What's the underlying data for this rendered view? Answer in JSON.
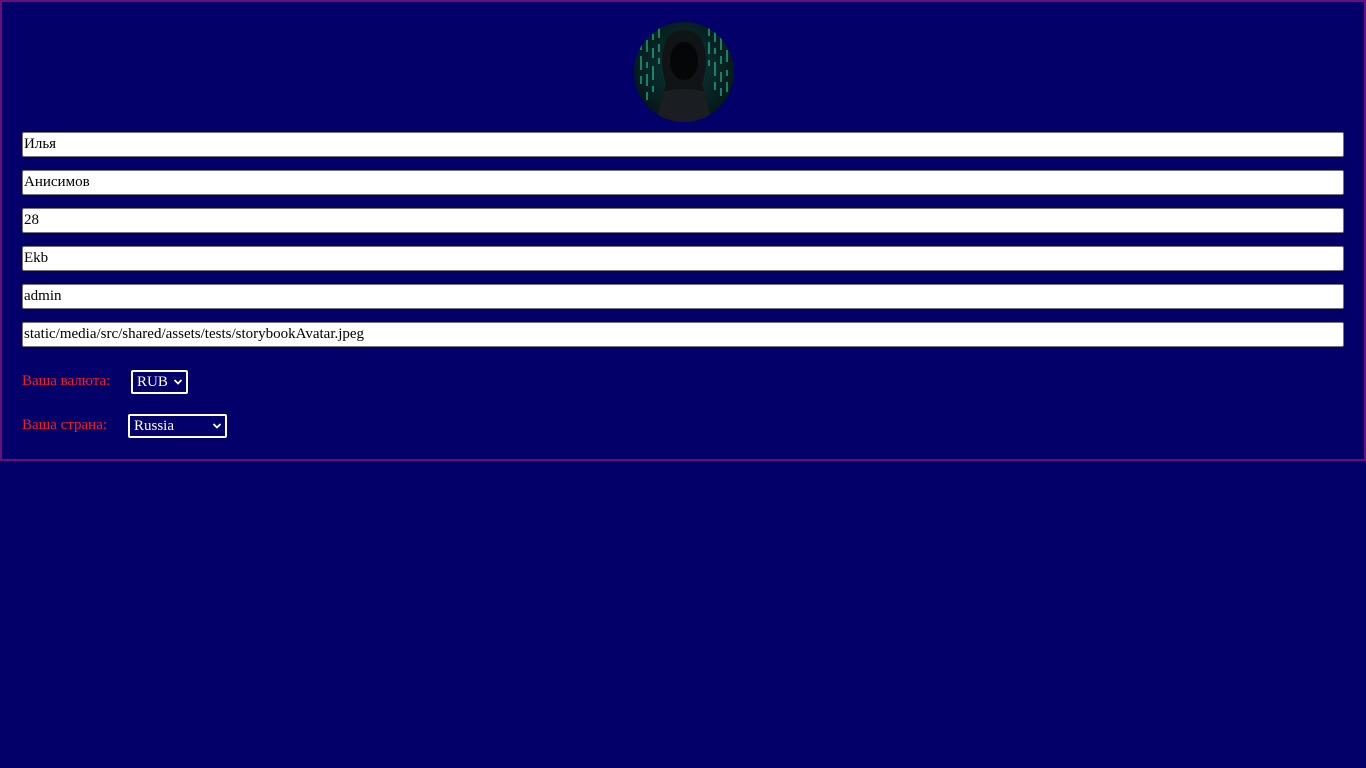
{
  "profile": {
    "avatar_icon": "hooded-hacker-avatar",
    "first_name": "Илья",
    "last_name": "Анисимов",
    "age": "28",
    "city": "Ekb",
    "username": "admin",
    "avatar_path": "static/media/src/shared/assets/tests/storybookAvatar.jpeg"
  },
  "currency": {
    "label": "Ваша валюта:",
    "selected": "RUB"
  },
  "country": {
    "label": "Ваша страна:",
    "selected": "Russia"
  },
  "colors": {
    "background": "#04006a",
    "border": "#6a0f7a",
    "label_red": "#ff1a1a"
  }
}
